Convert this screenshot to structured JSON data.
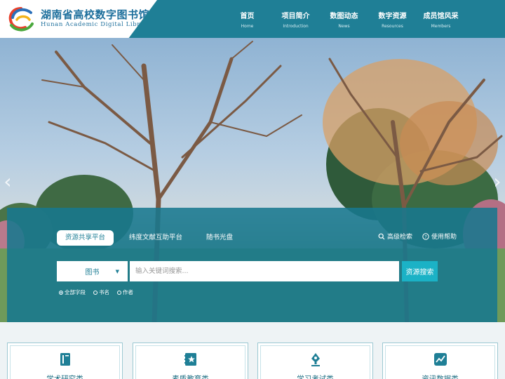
{
  "header": {
    "logo_cn": "湖南省高校数字图书馆",
    "logo_en": "Hunan Academic Digital Library",
    "nav": [
      {
        "cn": "首页",
        "en": "Home"
      },
      {
        "cn": "项目简介",
        "en": "Introduction"
      },
      {
        "cn": "数图动态",
        "en": "News"
      },
      {
        "cn": "数字资源",
        "en": "Resources"
      },
      {
        "cn": "成员馆风采",
        "en": "Members"
      }
    ]
  },
  "carousel": {
    "prev_icon": "chevron-left-icon",
    "next_icon": "chevron-right-icon"
  },
  "search": {
    "tabs": [
      "资源共享平台",
      "纬度文献互助平台",
      "随书光盘"
    ],
    "active_tab": "资源共享平台",
    "advanced_label": "高级检索",
    "help_label": "使用帮助",
    "type_value": "图书",
    "placeholder": "输入关键词搜索...",
    "button_label": "资源搜索",
    "fields": [
      "全部字段",
      "书名",
      "作者"
    ],
    "selected_field": "全部字段"
  },
  "categories": [
    {
      "label": "学术研究类",
      "icon": "book-icon"
    },
    {
      "label": "素质教育类",
      "icon": "star-book-icon"
    },
    {
      "label": "学习考试类",
      "icon": "pen-icon"
    },
    {
      "label": "资讯数据类",
      "icon": "chart-icon"
    }
  ],
  "colors": {
    "primary": "#1f7f96",
    "accent": "#1bb2c6",
    "logo_text": "#1d6f9c"
  }
}
